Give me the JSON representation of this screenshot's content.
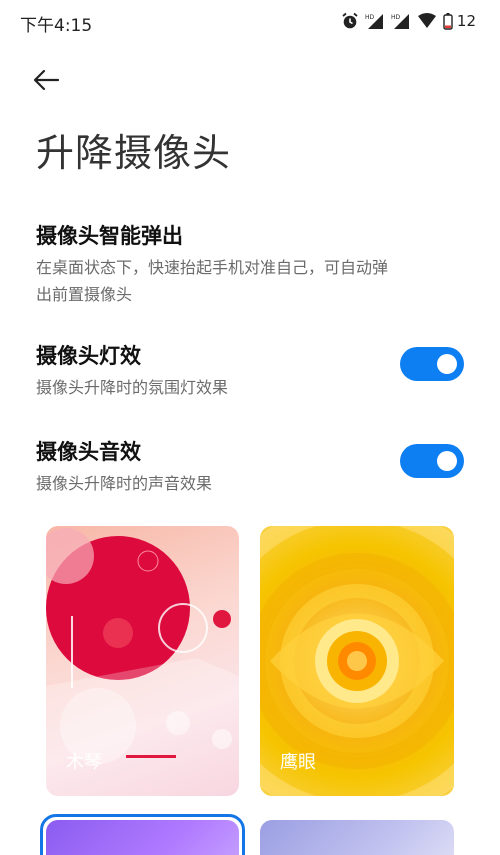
{
  "status_bar": {
    "time": "下午4:15",
    "battery_level": "12",
    "icons": [
      "alarm-icon",
      "hd-signal-icon",
      "hd-signal-icon",
      "wifi-icon",
      "battery-icon"
    ]
  },
  "header": {
    "title": "升降摄像头"
  },
  "settings": [
    {
      "title": "摄像头智能弹出",
      "description": "在桌面状态下，快速抬起手机对准自己，可自动弹出前置摄像头"
    },
    {
      "title": "摄像头灯效",
      "description": "摄像头升降时的氛围灯效果",
      "enabled": true
    },
    {
      "title": "摄像头音效",
      "description": "摄像头升降时的声音效果",
      "enabled": true
    }
  ],
  "sound_effects": [
    {
      "label": "木琴"
    },
    {
      "label": "鹰眼"
    },
    {
      "label": "",
      "selected": true
    },
    {
      "label": ""
    }
  ],
  "colors": {
    "accent": "#0d7ff2",
    "selection_outline": "#1476e6"
  }
}
